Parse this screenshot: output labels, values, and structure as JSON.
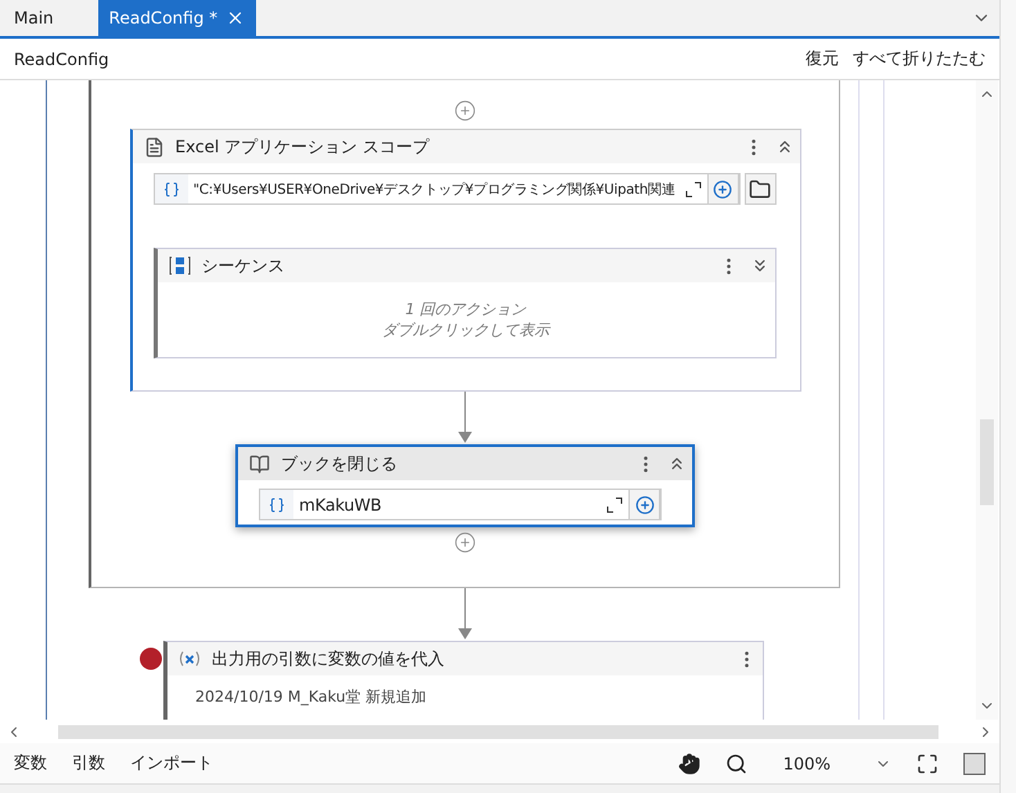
{
  "tabs": [
    {
      "label": "Main",
      "selected": false
    },
    {
      "label": "ReadConfig *",
      "selected": true
    }
  ],
  "breadcrumb": "ReadConfig",
  "header_actions": [
    "復元",
    "すべて折りたたむ"
  ],
  "scope": {
    "title": "Excel アプリケーション スコープ",
    "expanded": true,
    "path": "\"C:¥Users¥USER¥OneDrive¥デスクトップ¥プログラミング関係¥Uipath関連",
    "sequence": {
      "title": "シーケンス",
      "expanded": false,
      "summary": [
        "1 回のアクション",
        "ダブルクリックして表示"
      ]
    }
  },
  "close_book": {
    "title": "ブックを閉じる",
    "selected": true,
    "expanded": true,
    "workbook": "mKakuWB"
  },
  "assign": {
    "title": "出力用の引数に変数の値を代入",
    "breakpoint": true,
    "annotation": "2024/10/19 M_Kaku堂 新規追加"
  },
  "bottom_tabs": [
    "変数",
    "引数",
    "インポート"
  ],
  "zoom": "100%"
}
